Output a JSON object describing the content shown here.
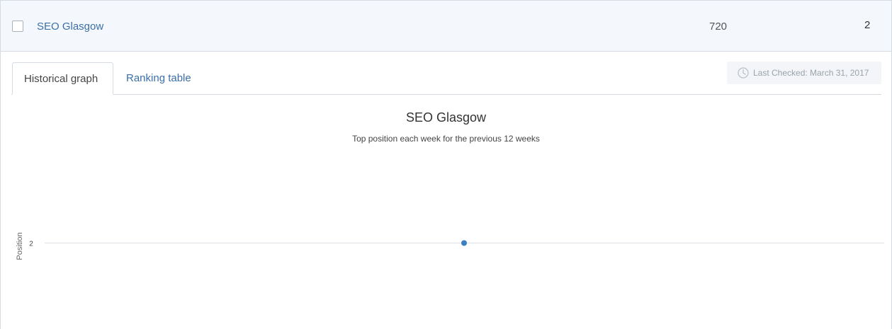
{
  "keyword_row": {
    "name": "SEO Glasgow",
    "volume": "720",
    "rank": "2"
  },
  "tabs": [
    {
      "label": "Historical graph",
      "active": true
    },
    {
      "label": "Ranking table",
      "active": false
    }
  ],
  "last_checked": {
    "icon": "clock-icon",
    "text": "Last Checked: March 31, 2017"
  },
  "colors": {
    "accent": "#3a7fc4",
    "link": "#3a6fa8",
    "row_bg": "#f4f8fc"
  },
  "chart_data": {
    "type": "scatter",
    "title": "SEO Glasgow",
    "subtitle": "Top position each week for the previous 12 weeks",
    "xlabel": "",
    "ylabel": "Position",
    "y_ticks": [
      "2"
    ],
    "grid": true,
    "series": [
      {
        "values": [
          2
        ]
      }
    ]
  }
}
